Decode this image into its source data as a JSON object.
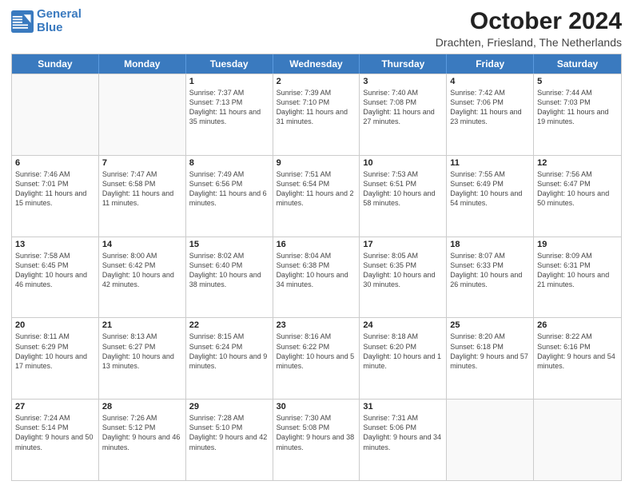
{
  "logo": {
    "line1": "General",
    "line2": "Blue"
  },
  "title": "October 2024",
  "subtitle": "Drachten, Friesland, The Netherlands",
  "days": [
    "Sunday",
    "Monday",
    "Tuesday",
    "Wednesday",
    "Thursday",
    "Friday",
    "Saturday"
  ],
  "weeks": [
    [
      {
        "day": "",
        "info": ""
      },
      {
        "day": "",
        "info": ""
      },
      {
        "day": "1",
        "info": "Sunrise: 7:37 AM\nSunset: 7:13 PM\nDaylight: 11 hours and 35 minutes."
      },
      {
        "day": "2",
        "info": "Sunrise: 7:39 AM\nSunset: 7:10 PM\nDaylight: 11 hours and 31 minutes."
      },
      {
        "day": "3",
        "info": "Sunrise: 7:40 AM\nSunset: 7:08 PM\nDaylight: 11 hours and 27 minutes."
      },
      {
        "day": "4",
        "info": "Sunrise: 7:42 AM\nSunset: 7:06 PM\nDaylight: 11 hours and 23 minutes."
      },
      {
        "day": "5",
        "info": "Sunrise: 7:44 AM\nSunset: 7:03 PM\nDaylight: 11 hours and 19 minutes."
      }
    ],
    [
      {
        "day": "6",
        "info": "Sunrise: 7:46 AM\nSunset: 7:01 PM\nDaylight: 11 hours and 15 minutes."
      },
      {
        "day": "7",
        "info": "Sunrise: 7:47 AM\nSunset: 6:58 PM\nDaylight: 11 hours and 11 minutes."
      },
      {
        "day": "8",
        "info": "Sunrise: 7:49 AM\nSunset: 6:56 PM\nDaylight: 11 hours and 6 minutes."
      },
      {
        "day": "9",
        "info": "Sunrise: 7:51 AM\nSunset: 6:54 PM\nDaylight: 11 hours and 2 minutes."
      },
      {
        "day": "10",
        "info": "Sunrise: 7:53 AM\nSunset: 6:51 PM\nDaylight: 10 hours and 58 minutes."
      },
      {
        "day": "11",
        "info": "Sunrise: 7:55 AM\nSunset: 6:49 PM\nDaylight: 10 hours and 54 minutes."
      },
      {
        "day": "12",
        "info": "Sunrise: 7:56 AM\nSunset: 6:47 PM\nDaylight: 10 hours and 50 minutes."
      }
    ],
    [
      {
        "day": "13",
        "info": "Sunrise: 7:58 AM\nSunset: 6:45 PM\nDaylight: 10 hours and 46 minutes."
      },
      {
        "day": "14",
        "info": "Sunrise: 8:00 AM\nSunset: 6:42 PM\nDaylight: 10 hours and 42 minutes."
      },
      {
        "day": "15",
        "info": "Sunrise: 8:02 AM\nSunset: 6:40 PM\nDaylight: 10 hours and 38 minutes."
      },
      {
        "day": "16",
        "info": "Sunrise: 8:04 AM\nSunset: 6:38 PM\nDaylight: 10 hours and 34 minutes."
      },
      {
        "day": "17",
        "info": "Sunrise: 8:05 AM\nSunset: 6:35 PM\nDaylight: 10 hours and 30 minutes."
      },
      {
        "day": "18",
        "info": "Sunrise: 8:07 AM\nSunset: 6:33 PM\nDaylight: 10 hours and 26 minutes."
      },
      {
        "day": "19",
        "info": "Sunrise: 8:09 AM\nSunset: 6:31 PM\nDaylight: 10 hours and 21 minutes."
      }
    ],
    [
      {
        "day": "20",
        "info": "Sunrise: 8:11 AM\nSunset: 6:29 PM\nDaylight: 10 hours and 17 minutes."
      },
      {
        "day": "21",
        "info": "Sunrise: 8:13 AM\nSunset: 6:27 PM\nDaylight: 10 hours and 13 minutes."
      },
      {
        "day": "22",
        "info": "Sunrise: 8:15 AM\nSunset: 6:24 PM\nDaylight: 10 hours and 9 minutes."
      },
      {
        "day": "23",
        "info": "Sunrise: 8:16 AM\nSunset: 6:22 PM\nDaylight: 10 hours and 5 minutes."
      },
      {
        "day": "24",
        "info": "Sunrise: 8:18 AM\nSunset: 6:20 PM\nDaylight: 10 hours and 1 minute."
      },
      {
        "day": "25",
        "info": "Sunrise: 8:20 AM\nSunset: 6:18 PM\nDaylight: 9 hours and 57 minutes."
      },
      {
        "day": "26",
        "info": "Sunrise: 8:22 AM\nSunset: 6:16 PM\nDaylight: 9 hours and 54 minutes."
      }
    ],
    [
      {
        "day": "27",
        "info": "Sunrise: 7:24 AM\nSunset: 5:14 PM\nDaylight: 9 hours and 50 minutes."
      },
      {
        "day": "28",
        "info": "Sunrise: 7:26 AM\nSunset: 5:12 PM\nDaylight: 9 hours and 46 minutes."
      },
      {
        "day": "29",
        "info": "Sunrise: 7:28 AM\nSunset: 5:10 PM\nDaylight: 9 hours and 42 minutes."
      },
      {
        "day": "30",
        "info": "Sunrise: 7:30 AM\nSunset: 5:08 PM\nDaylight: 9 hours and 38 minutes."
      },
      {
        "day": "31",
        "info": "Sunrise: 7:31 AM\nSunset: 5:06 PM\nDaylight: 9 hours and 34 minutes."
      },
      {
        "day": "",
        "info": ""
      },
      {
        "day": "",
        "info": ""
      }
    ]
  ]
}
